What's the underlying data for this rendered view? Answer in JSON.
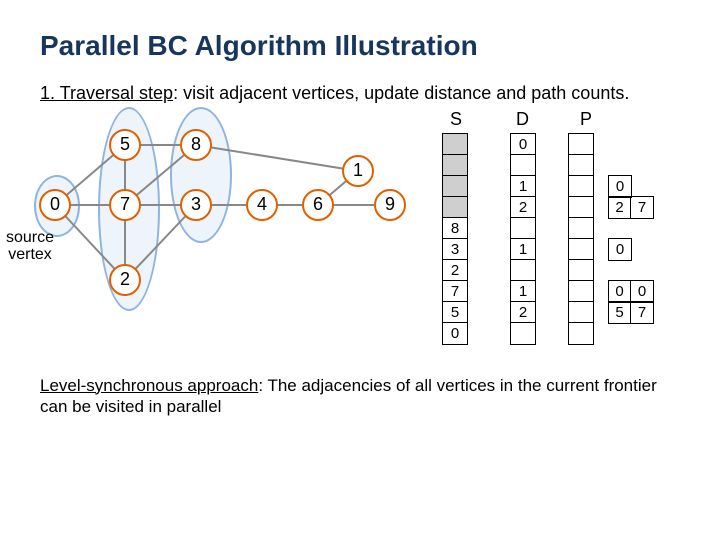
{
  "title": "Parallel BC Algorithm Illustration",
  "step_prefix": "1. Traversal step",
  "step_rest": ": visit adjacent vertices, update distance and path counts.",
  "approach_prefix": "Level-synchronous approach",
  "approach_rest": ": The adjacencies of all vertices in the current frontier can be visited in parallel",
  "source_label_line1": "source",
  "source_label_line2": "vertex",
  "nodes": {
    "n0": "0",
    "n5": "5",
    "n7": "7",
    "n2": "2",
    "n8": "8",
    "n3": "3",
    "n4": "4",
    "n6": "6",
    "n1": "1",
    "n9": "9"
  },
  "columns": {
    "S": {
      "label": "S",
      "cells": [
        "8",
        "3",
        "2",
        "7",
        "5",
        "0"
      ]
    },
    "D": {
      "label": "D",
      "cells": [
        "0",
        "1",
        "2",
        "1",
        "1",
        "2"
      ]
    },
    "P": {
      "label": "P"
    }
  },
  "P_side": {
    "r1": [
      "0"
    ],
    "r2": [
      "2",
      "7"
    ],
    "r3": [
      "0"
    ],
    "r4": [
      "0",
      "0"
    ],
    "r5": [
      "5",
      "7"
    ]
  }
}
